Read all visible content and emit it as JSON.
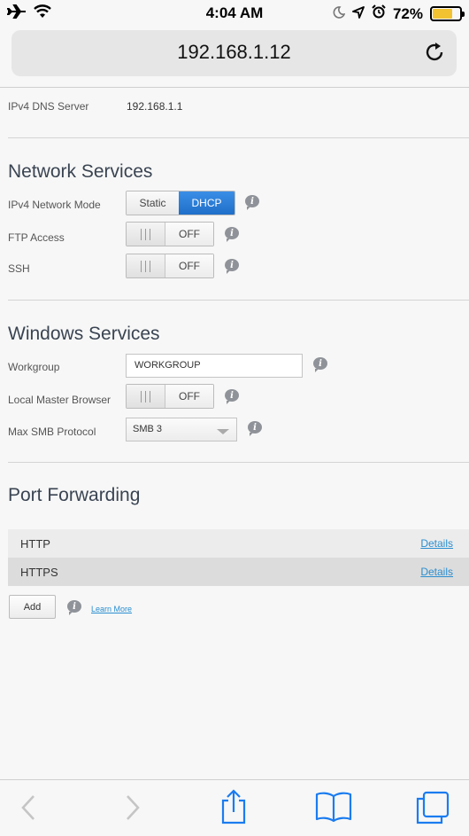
{
  "status_bar": {
    "time": "4:04 AM",
    "battery": "72%",
    "battery_level": 0.72
  },
  "browser": {
    "url": "192.168.1.12"
  },
  "network": {
    "dns_label": "IPv4 DNS Server",
    "dns_value": "192.168.1.1"
  },
  "network_services": {
    "title": "Network Services",
    "mode_label": "IPv4 Network Mode",
    "mode_options": [
      "Static",
      "DHCP"
    ],
    "mode_selected": "DHCP",
    "ftp_label": "FTP Access",
    "ftp_state": "OFF",
    "ssh_label": "SSH",
    "ssh_state": "OFF"
  },
  "windows_services": {
    "title": "Windows Services",
    "workgroup_label": "Workgroup",
    "workgroup_value": "WORKGROUP",
    "master_label": "Local Master Browser",
    "master_state": "OFF",
    "smb_label": "Max SMB Protocol",
    "smb_value": "SMB 3"
  },
  "port_forwarding": {
    "title": "Port Forwarding",
    "rows": [
      {
        "name": "HTTP",
        "link": "Details"
      },
      {
        "name": "HTTPS",
        "link": "Details"
      }
    ],
    "add_label": "Add",
    "learn_more": "Learn More"
  },
  "info_glyph": "i",
  "colors": {
    "accent": "#2f80d8",
    "link": "#2a8ed0",
    "battery": "#f2c230"
  }
}
